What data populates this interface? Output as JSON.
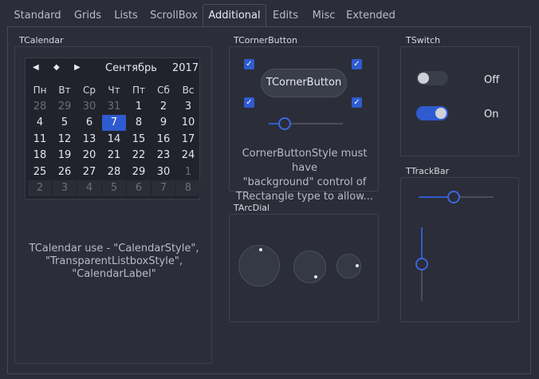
{
  "tabs": [
    {
      "label": "Standard"
    },
    {
      "label": "Grids"
    },
    {
      "label": "Lists"
    },
    {
      "label": "ScrollBox"
    },
    {
      "label": "Additional"
    },
    {
      "label": "Edits"
    },
    {
      "label": "Misc"
    },
    {
      "label": "Extended"
    }
  ],
  "active_tab": "Additional",
  "calendar_group": {
    "label": "TCalendar",
    "nav_prev": "◀",
    "nav_today": "◆",
    "nav_next": "▶",
    "month": "Сентябрь",
    "year": "2017",
    "weekdays": [
      "Пн",
      "Вт",
      "Ср",
      "Чт",
      "Пт",
      "Сб",
      "Вс"
    ],
    "weeks": [
      [
        "28",
        "29",
        "30",
        "31",
        "1",
        "2",
        "3"
      ],
      [
        "4",
        "5",
        "6",
        "7",
        "8",
        "9",
        "10"
      ],
      [
        "11",
        "12",
        "13",
        "14",
        "15",
        "16",
        "17"
      ],
      [
        "18",
        "19",
        "20",
        "21",
        "22",
        "23",
        "24"
      ],
      [
        "25",
        "26",
        "27",
        "28",
        "29",
        "30",
        "1"
      ],
      [
        "2",
        "3",
        "4",
        "5",
        "6",
        "7",
        "8"
      ]
    ],
    "selected_day": "7",
    "description_lines": [
      "TCalendar use - \"CalendarStyle\",",
      "\"TransparentListboxStyle\",",
      "\"CalendarLabel\""
    ]
  },
  "corner_button_group": {
    "label": "TCornerButton",
    "button_label": "TCornerButton",
    "checkboxes_checked": [
      true,
      true,
      true,
      true
    ],
    "slider_value": 0.22,
    "description_lines": [
      "CornerButtonStyle must have",
      "\"background\" control of",
      "TRectangle type to allow..."
    ]
  },
  "arcdial_group": {
    "label": "TArcDial",
    "dials": [
      {
        "name": "large"
      },
      {
        "name": "medium"
      },
      {
        "name": "small"
      }
    ]
  },
  "switch_group": {
    "label": "TSwitch",
    "switches": [
      {
        "state": "off",
        "label": "Off"
      },
      {
        "state": "on",
        "label": "On"
      }
    ]
  },
  "trackbar_group": {
    "label": "TTrackBar",
    "horizontal_value": 0.47,
    "vertical_value": 0.5
  },
  "colors": {
    "background": "#2b2d38",
    "accent": "#2f5bd0",
    "text": "#d7d9e0"
  }
}
